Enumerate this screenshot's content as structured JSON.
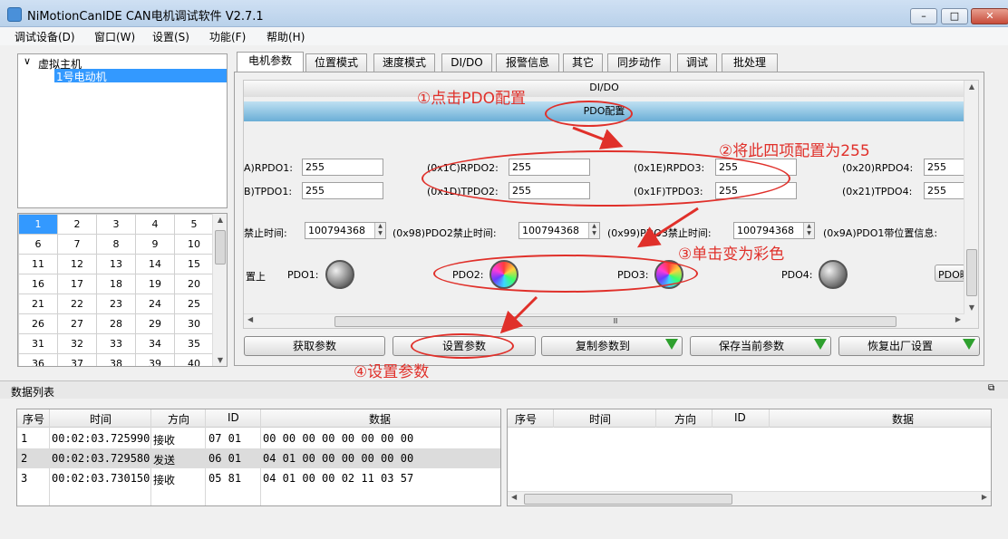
{
  "window": {
    "title": "NiMotionCanIDE CAN电机调试软件 V2.7.1",
    "minimize": "–",
    "maximize": "□",
    "close": "✕"
  },
  "menu": [
    "调试设备(D)",
    "窗口(W)",
    "设置(S)",
    "功能(F)",
    "帮助(H)"
  ],
  "tree": {
    "root": "虚拟主机",
    "child": "1号电动机",
    "expand_glyph": "∨"
  },
  "grid": {
    "rows": [
      [
        "1",
        "2",
        "3",
        "4",
        "5"
      ],
      [
        "6",
        "7",
        "8",
        "9",
        "10"
      ],
      [
        "11",
        "12",
        "13",
        "14",
        "15"
      ],
      [
        "16",
        "17",
        "18",
        "19",
        "20"
      ],
      [
        "21",
        "22",
        "23",
        "24",
        "25"
      ],
      [
        "26",
        "27",
        "28",
        "29",
        "30"
      ],
      [
        "31",
        "32",
        "33",
        "34",
        "35"
      ],
      [
        "36",
        "37",
        "38",
        "39",
        "40"
      ]
    ],
    "selected": "1"
  },
  "tabs": [
    "电机参数",
    "位置模式",
    "速度模式",
    "DI/DO",
    "报警信息",
    "其它",
    "同步动作",
    "调试",
    "批处理"
  ],
  "sections": {
    "dido": "DI/DO",
    "pdo": "PDO配置"
  },
  "rpdo": {
    "label1": "A)RPDO1:",
    "value1": "255",
    "label2": "(0x1C)RPDO2:",
    "value2": "255",
    "label3": "(0x1E)RPDO3:",
    "value3": "255",
    "label4": "(0x20)RPDO4:",
    "value4": "255"
  },
  "tpdo": {
    "label1": "B)TPDO1:",
    "value1": "255",
    "label2": "(0x1D)TPDO2:",
    "value2": "255",
    "label3": "(0x1F)TPDO3:",
    "value3": "255",
    "label4": "(0x21)TPDO4:",
    "value4": "255"
  },
  "inhibit": {
    "label1": "禁止时间:",
    "value1": "100794368",
    "label2": "(0x98)PDO2禁止时间:",
    "value2": "100794368",
    "label3": "(0x99)PDO3禁止时间:",
    "value3": "100794368",
    "label4": "(0x9A)PDO1带位置信息:"
  },
  "leds": {
    "prefix": "置上",
    "pdo1": "PDO1:",
    "pdo2": "PDO2:",
    "pdo3": "PDO3:",
    "pdo4": "PDO4:",
    "mapbtn": "PDO映"
  },
  "buttons": {
    "get": "获取参数",
    "set": "设置参数",
    "copy": "复制参数到",
    "save": "保存当前参数",
    "reset": "恢复出厂设置"
  },
  "annotations": {
    "a1": "①点击PDO配置",
    "a2": "②将此四项配置为255",
    "a3": "③单击变为彩色",
    "a4": "④设置参数"
  },
  "datalist": {
    "title": "数据列表",
    "headers": [
      "序号",
      "时间",
      "方向",
      "ID",
      "数据"
    ],
    "rows": [
      [
        "1",
        "00:02:03.725990",
        "接收",
        "07 01",
        "00 00 00 00 00 00 00 00"
      ],
      [
        "2",
        "00:02:03.729580",
        "发送",
        "06 01",
        "04 01 00 00 00 00 00 00"
      ],
      [
        "3",
        "00:02:03.730150",
        "接收",
        "05 81",
        "04 01 00 00 02 11 03 57"
      ]
    ]
  },
  "colors": {
    "accent": "#3399ff",
    "annotation": "#e0302a",
    "pdo_band": "#6aaed6"
  }
}
